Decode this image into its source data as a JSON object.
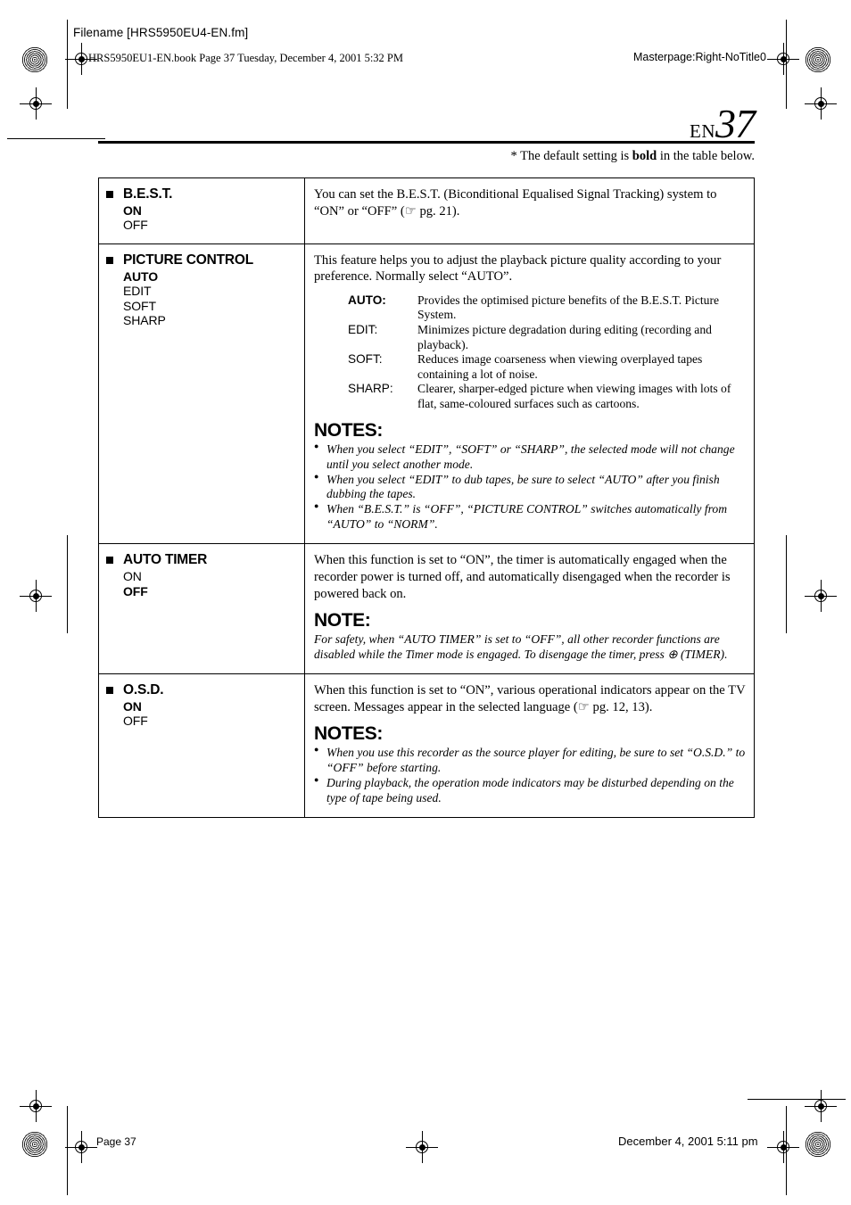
{
  "header": {
    "filename": "Filename [HRS5950EU4-EN.fm]",
    "book_line": "HRS5950EU1-EN.book  Page 37  Tuesday, December 4, 2001  5:32 PM",
    "masterpage": "Masterpage:Right-NoTitle0"
  },
  "page_title": {
    "prefix": "EN",
    "number": "37"
  },
  "default_note": {
    "before": "* The default setting is ",
    "bold": "bold",
    "after": " in the table below."
  },
  "table": {
    "rows": [
      {
        "name": "B.E.S.T.",
        "values": [
          {
            "text": "ON",
            "bold": true
          },
          {
            "text": "OFF",
            "bold": false
          }
        ],
        "description": "You can set the B.E.S.T. (Biconditional Equalised Signal Tracking) system to “ON” or “OFF” (☞ pg. 21)."
      },
      {
        "name": "PICTURE CONTROL",
        "values": [
          {
            "text": "AUTO",
            "bold": true
          },
          {
            "text": "EDIT",
            "bold": false
          },
          {
            "text": "SOFT",
            "bold": false
          },
          {
            "text": "SHARP",
            "bold": false
          }
        ],
        "description": "This feature helps you to adjust the playback picture quality according to your preference. Normally select “AUTO”.",
        "definitions": [
          {
            "term": "AUTO:",
            "bold": true,
            "desc": "Provides the optimised picture benefits of the B.E.S.T. Picture System."
          },
          {
            "term": "EDIT:",
            "bold": false,
            "desc": "Minimizes picture degradation during editing (recording and playback)."
          },
          {
            "term": "SOFT:",
            "bold": false,
            "desc": "Reduces image coarseness when viewing overplayed tapes containing a lot of noise."
          },
          {
            "term": "SHARP:",
            "bold": false,
            "desc": "Clearer, sharper-edged picture when viewing images with lots of flat, same-coloured surfaces such as cartoons."
          }
        ],
        "notes_heading": "NOTES:",
        "notes": [
          "When you select “EDIT”, “SOFT” or “SHARP”, the selected mode will not change until you select another mode.",
          "When you select “EDIT” to dub tapes, be sure to select “AUTO” after you finish dubbing the tapes.",
          "When “B.E.S.T.” is “OFF”, “PICTURE CONTROL” switches automatically from “AUTO” to “NORM”."
        ]
      },
      {
        "name": "AUTO TIMER",
        "values": [
          {
            "text": "ON",
            "bold": false
          },
          {
            "text": "OFF",
            "bold": true
          }
        ],
        "description": "When this function is set to “ON”, the timer is automatically engaged when the recorder power is turned off, and automatically disengaged when the recorder is powered back on.",
        "notes_heading": "NOTE:",
        "note_paragraph": "For safety, when “AUTO TIMER” is set to “OFF”, all other recorder functions are disabled while the Timer mode is engaged. To disengage the timer, press ⊕ (TIMER)."
      },
      {
        "name": "O.S.D.",
        "values": [
          {
            "text": "ON",
            "bold": true
          },
          {
            "text": "OFF",
            "bold": false
          }
        ],
        "description": "When this function is set to “ON”, various operational indicators appear on the TV screen. Messages appear in the selected language (☞ pg. 12, 13).",
        "notes_heading": "NOTES:",
        "notes": [
          "When you use this recorder as the source player for editing, be sure to set “O.S.D.” to “OFF” before starting.",
          "During playback, the operation mode indicators may be disturbed depending on the type of tape being used."
        ]
      }
    ]
  },
  "footer": {
    "page_label": "Page 37",
    "timestamp": "December 4, 2001 5:11 pm"
  }
}
